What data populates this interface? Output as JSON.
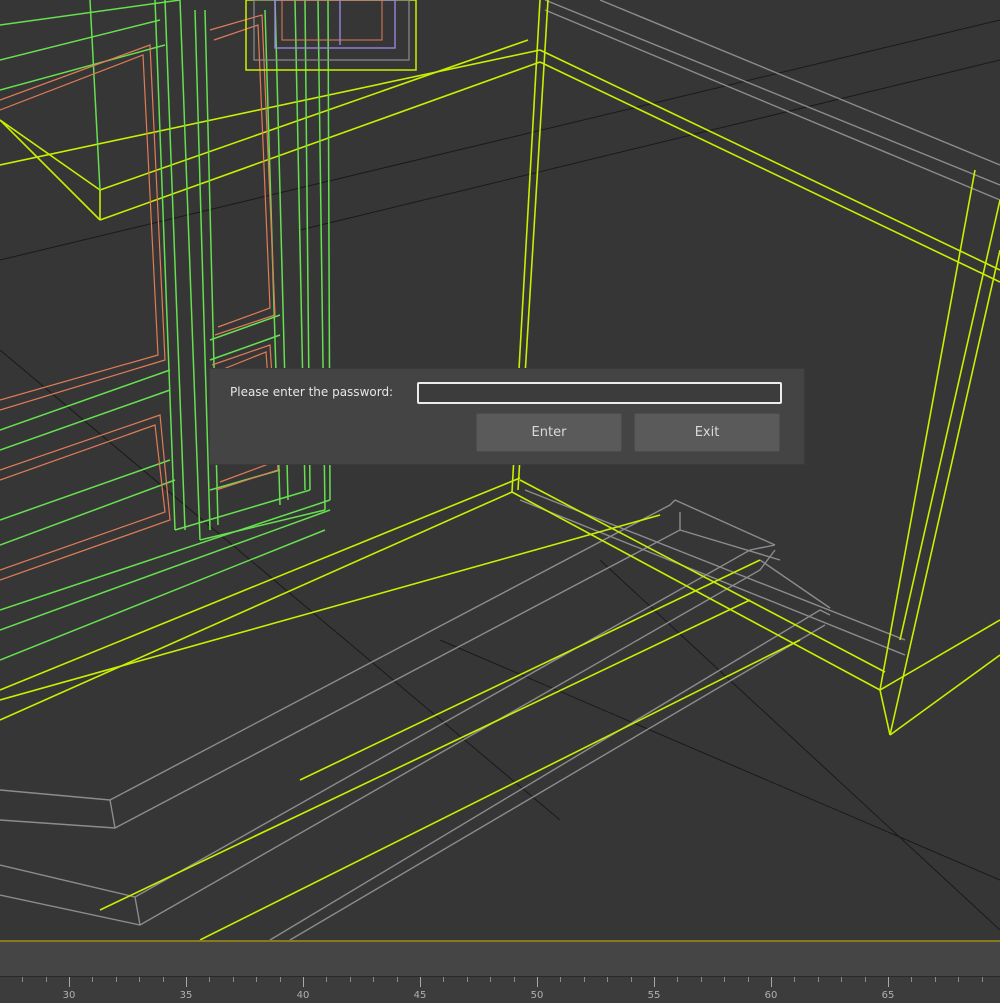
{
  "dialog": {
    "prompt_label": "Please enter the password:",
    "password_value": "",
    "enter_label": "Enter",
    "exit_label": "Exit"
  },
  "timeline": {
    "ruler_labels": [
      "30",
      "35",
      "40",
      "45",
      "50",
      "55",
      "60",
      "65"
    ]
  },
  "colors": {
    "viewport_background": "#363636",
    "wireframe_yellow": "#c8f000",
    "wireframe_green": "#66e050",
    "wireframe_orange": "#e07c56",
    "wireframe_gray": "#8a8a8a",
    "dialog_background": "#444444",
    "button_background": "#5a5a5a",
    "timeline_accent": "#8a7a1e"
  }
}
